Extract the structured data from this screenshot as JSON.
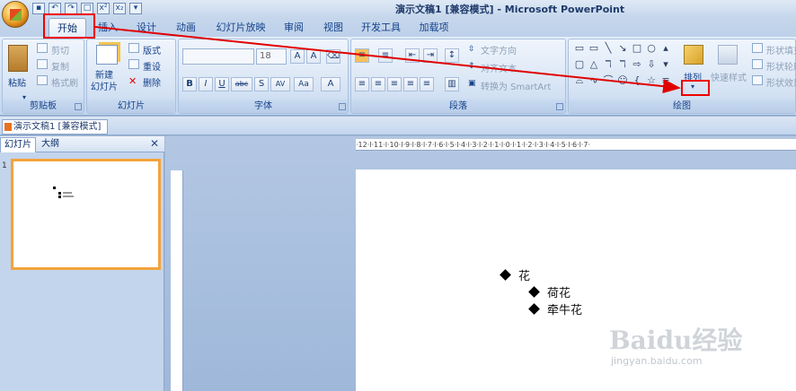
{
  "window": {
    "title": "演示文稿1 [兼容模式] - Microsoft PowerPoint"
  },
  "tabs": [
    "开始",
    "插入",
    "设计",
    "动画",
    "幻灯片放映",
    "审阅",
    "视图",
    "开发工具",
    "加载项"
  ],
  "clipboard": {
    "paste": "粘贴",
    "cut": "剪切",
    "copy": "复制",
    "format_painter": "格式刷",
    "label": "剪贴板"
  },
  "slides_group": {
    "new_slide": "新建\n幻灯片",
    "layout": "版式",
    "reset": "重设",
    "delete": "删除",
    "label": "幻灯片"
  },
  "font_group": {
    "size_value": "18",
    "bold": "B",
    "italic": "I",
    "underline": "U",
    "strike": "abc",
    "shadow": "S",
    "spacing": "AV",
    "case": "Aa",
    "label": "字体"
  },
  "paragraph_group": {
    "text_direction": "文字方向",
    "align_text": "对齐文本",
    "convert_smartart": "转换为 SmartArt",
    "label": "段落"
  },
  "drawing_group": {
    "arrange": "排列",
    "quick_styles": "快速样式",
    "shape_fill": "形状填充",
    "shape_outline": "形状轮廓",
    "shape_effects": "形状效果",
    "label": "绘图"
  },
  "doc_tab": "演示文稿1 [兼容模式]",
  "pane": {
    "tab_slides": "幻灯片",
    "tab_outline": "大纲",
    "slide_number": "1"
  },
  "ruler_text": "·12·l·11·l·10·l·9·l·8·l·7·l·6·l·5·l·4·l·3·l·2·l·1·l·0·l·1·l·2·l·3·l·4·l·5·l·6·l·7·",
  "slide": {
    "bullets": [
      "花",
      "荷花",
      "牵牛花"
    ]
  },
  "watermark": {
    "main": "Baidu经验",
    "sub": "jingyan.baidu.com"
  },
  "colors": {
    "annotation": "#e00000",
    "ribbon": "#d3e1f3",
    "selected_thumb_border": "#f3a33b"
  }
}
